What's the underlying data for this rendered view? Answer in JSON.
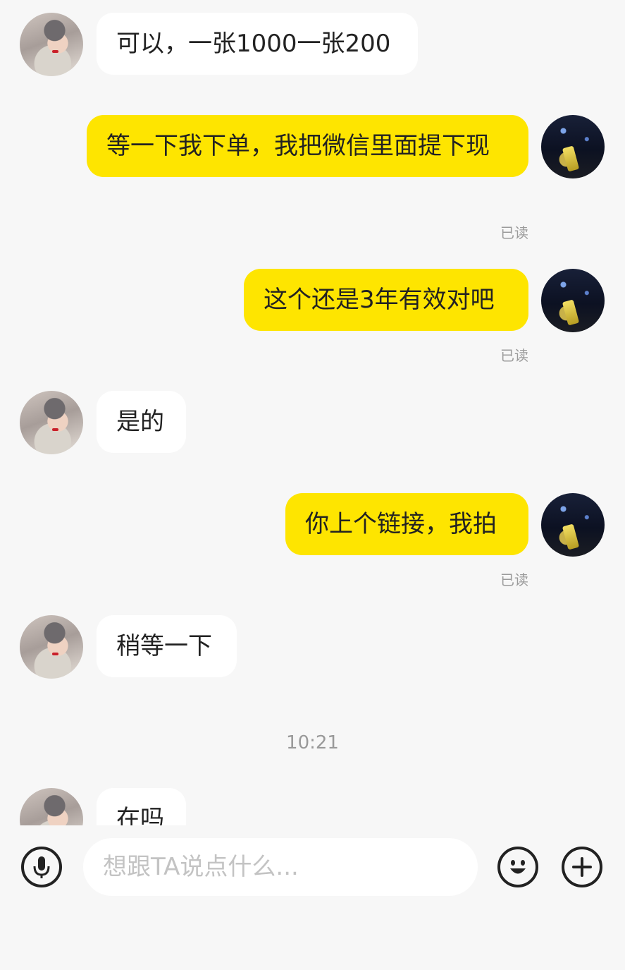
{
  "messages": [
    {
      "from": "other",
      "text": "可以，一张1000一张200"
    },
    {
      "from": "me",
      "text": "等一下我下单，我把微信里面提下现",
      "status": "已读"
    },
    {
      "from": "me",
      "text": "这个还是3年有效对吧",
      "status": "已读"
    },
    {
      "from": "other",
      "text": "是的"
    },
    {
      "from": "me",
      "text": "你上个链接，我拍",
      "status": "已读"
    },
    {
      "from": "other",
      "text": "稍等一下"
    },
    {
      "from": "other",
      "text": "在吗"
    }
  ],
  "timestamp": "10:21",
  "input": {
    "placeholder": "想跟TA说点什么..."
  },
  "icons": {
    "voice": "microphone-icon",
    "emoji": "smiley-icon",
    "more": "plus-icon"
  }
}
